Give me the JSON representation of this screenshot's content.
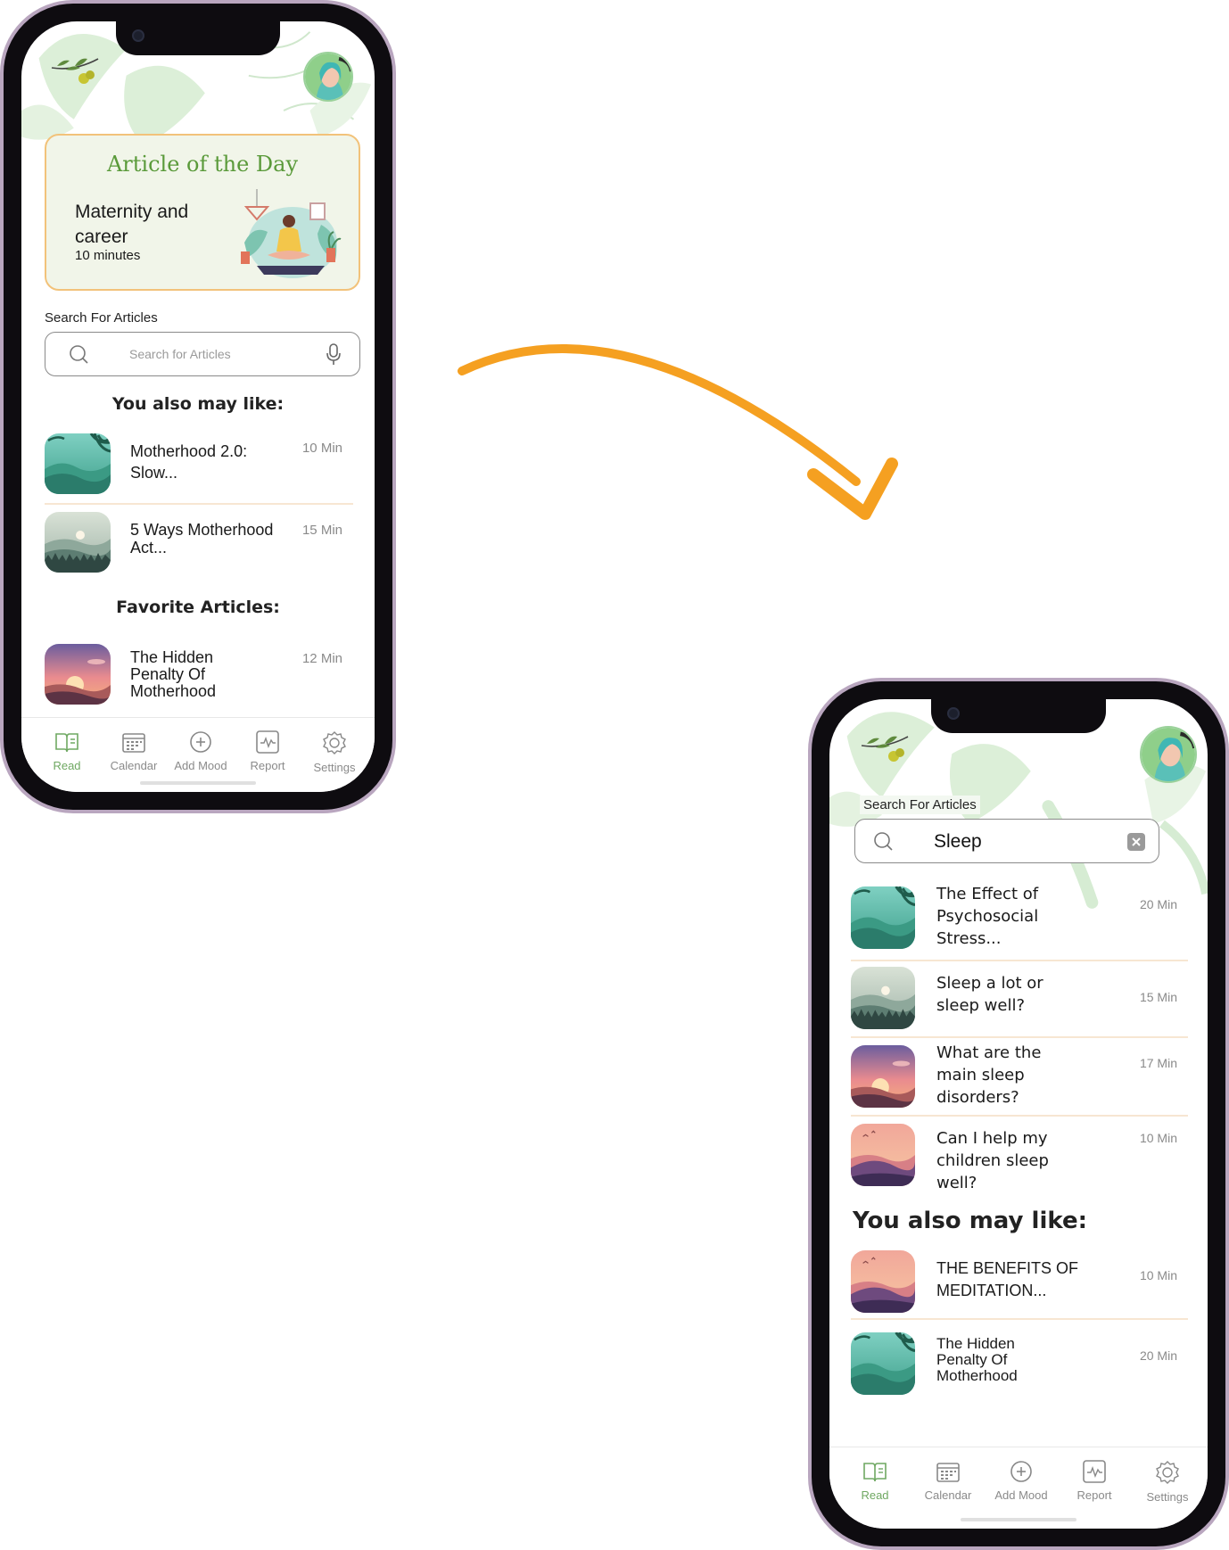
{
  "colors": {
    "brand_green": "#5a9a3a",
    "accent_orange": "#f5a021",
    "card_border": "#f2c27a",
    "card_bg": "#f1f5e9",
    "leaf_green": "#cfe7cc",
    "muted_text": "#8a8a8a"
  },
  "left_phone": {
    "article_of_day": {
      "heading": "Article of the Day",
      "title": "Maternity and career",
      "duration": "10 minutes"
    },
    "search": {
      "label": "Search For Articles",
      "placeholder": "Search for Articles",
      "icon": "search-icon",
      "voice_icon": "microphone-icon"
    },
    "also_like": {
      "heading": "You also may like:",
      "items": [
        {
          "title": "Motherhood 2.0: Slow...",
          "duration": "10 Min",
          "thumb": "green-forest"
        },
        {
          "title": "5 Ways Motherhood Act...",
          "duration": "15 Min",
          "thumb": "misty-mountains"
        }
      ]
    },
    "favorites": {
      "heading": "Favorite Articles:",
      "items": [
        {
          "title": "The Hidden Penalty Of Motherhood",
          "duration": "12 Min",
          "thumb": "purple-sunset"
        }
      ]
    }
  },
  "right_phone": {
    "search": {
      "label": "Search For Articles",
      "value": "Sleep",
      "icon": "search-icon",
      "clear_icon": "clear-icon"
    },
    "results": [
      {
        "title": "The Effect of Psychosocial Stress...",
        "duration": "20 Min",
        "thumb": "green-forest"
      },
      {
        "title": "Sleep a lot or sleep well?",
        "duration": "15 Min",
        "thumb": "misty-mountains"
      },
      {
        "title": "What are the main sleep disorders?",
        "duration": "17 Min",
        "thumb": "purple-sunset"
      },
      {
        "title": "Can I help my children sleep well?",
        "duration": "10 Min",
        "thumb": "pink-sunset"
      }
    ],
    "also_like": {
      "heading": "You also may like:",
      "items": [
        {
          "title": "THE BENEFITS OF MEDITATION...",
          "duration": "10 Min",
          "thumb": "pink-sunset"
        },
        {
          "title": "The Hidden Penalty Of Motherhood",
          "duration": "20 Min",
          "thumb": "green-forest"
        }
      ]
    }
  },
  "tabbar": {
    "tabs": [
      {
        "label": "Read",
        "icon": "book-icon",
        "active": true
      },
      {
        "label": "Calendar",
        "icon": "calendar-icon",
        "active": false
      },
      {
        "label": "Add Mood",
        "icon": "plus-circle-icon",
        "active": false
      },
      {
        "label": "Report",
        "icon": "report-icon",
        "active": false
      },
      {
        "label": "Settings",
        "icon": "gear-icon",
        "active": false
      }
    ]
  }
}
